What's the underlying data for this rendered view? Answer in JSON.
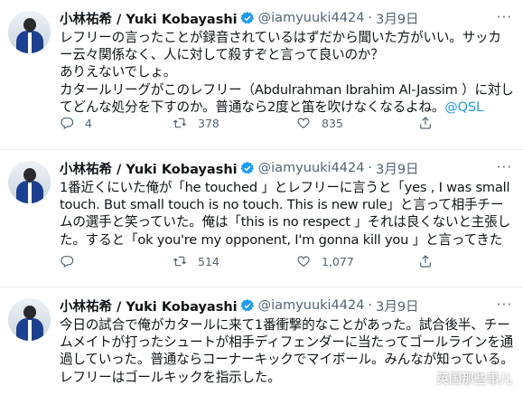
{
  "tweets": [
    {
      "name": "小林祐希 / Yuki Kobayashi",
      "handle": "@iamyuuki4424",
      "date": "3月9日",
      "text": "レフリーの言ったことが録音されているはずだから聞いた方がいい。サッカー云々関係なく、人に対して殺すぞと言って良いのか？\nありえないでしょ。\nカタールリーグがこのレフリー（Abdulrahman Ibrahim Al-Jassim ）に対してどんな処分を下すのか。普通なら2度と笛を吹けなくなるよね。",
      "mention": "@QSL",
      "replies": "4",
      "retweets": "378",
      "likes": "835"
    },
    {
      "name": "小林祐希 / Yuki Kobayashi",
      "handle": "@iamyuuki4424",
      "date": "3月9日",
      "text": "1番近くにいた俺が「he touched 」とレフリーに言うと「yes , I was small touch. But small touch is no touch. This is new rule」と言って相手チームの選手と笑っていた。俺は「this is no respect 」それは良くないと主張した。すると「ok you're my opponent, I'm gonna kill you 」と言ってきた",
      "mention": "",
      "replies": "",
      "retweets": "514",
      "likes": "1,077"
    },
    {
      "name": "小林祐希 / Yuki Kobayashi",
      "handle": "@iamyuuki4424",
      "date": "3月9日",
      "text": "今日の試合で俺がカタールに来て1番衝撃的なことがあった。試合後半、チームメイトが打ったシュートが相手ディフェンダーに当たってゴールラインを通過していった。普通ならコーナーキックでマイボール。みんなが知っている。レフリーはゴールキックを指示した。",
      "mention": "",
      "replies": "",
      "retweets": "",
      "likes": ""
    }
  ],
  "separator": "·",
  "more_label": "···",
  "watermark": "英国那些事儿",
  "colors": {
    "accent": "#1d9bf0",
    "muted": "#536471",
    "text": "#0f1419"
  },
  "icons": [
    "verified-badge-icon",
    "reply-icon",
    "retweet-icon",
    "like-icon",
    "share-icon",
    "more-icon"
  ]
}
